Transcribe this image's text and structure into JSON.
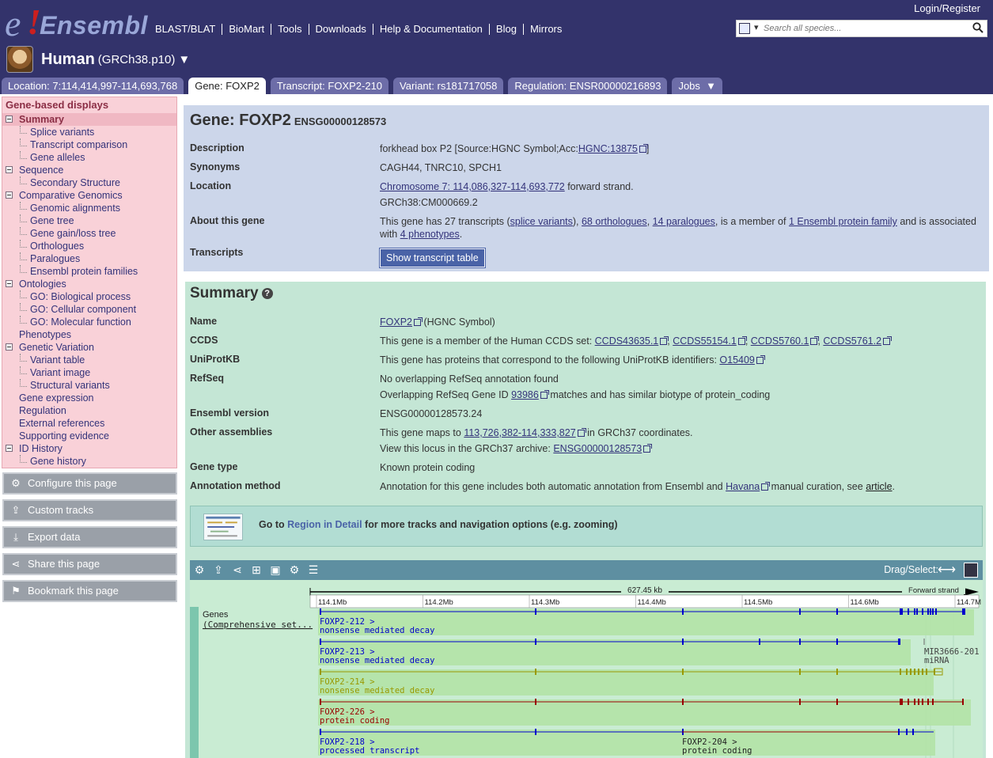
{
  "header": {
    "logo": "Ensembl",
    "nav": [
      "BLAST/BLAT",
      "BioMart",
      "Tools",
      "Downloads",
      "Help & Documentation",
      "Blog",
      "Mirrors"
    ],
    "login": "Login/Register",
    "search_placeholder": "Search all species...",
    "species": "Human",
    "assembly": "(GRCh38.p10)",
    "species_dropdown": "▼"
  },
  "tabs": [
    {
      "label": "Location: 7:114,414,997-114,693,768",
      "active": false
    },
    {
      "label": "Gene: FOXP2",
      "active": true
    },
    {
      "label": "Transcript: FOXP2-210",
      "active": false
    },
    {
      "label": "Variant: rs181717058",
      "active": false
    },
    {
      "label": "Regulation: ENSR00000216893",
      "active": false
    },
    {
      "label": "Jobs",
      "active": false
    }
  ],
  "jobs_arrow": "▼",
  "leftnav": {
    "header": "Gene-based displays",
    "items": [
      {
        "label": "Summary",
        "level": 0,
        "toggle": true,
        "selected": true
      },
      {
        "label": "Splice variants",
        "level": 1
      },
      {
        "label": "Transcript comparison",
        "level": 1
      },
      {
        "label": "Gene alleles",
        "level": 1
      },
      {
        "label": "Sequence",
        "level": 0,
        "toggle": true
      },
      {
        "label": "Secondary Structure",
        "level": 1
      },
      {
        "label": "Comparative Genomics",
        "level": 0,
        "toggle": true
      },
      {
        "label": "Genomic alignments",
        "level": 1
      },
      {
        "label": "Gene tree",
        "level": 1
      },
      {
        "label": "Gene gain/loss tree",
        "level": 1
      },
      {
        "label": "Orthologues",
        "level": 1
      },
      {
        "label": "Paralogues",
        "level": 1
      },
      {
        "label": "Ensembl protein families",
        "level": 1
      },
      {
        "label": "Ontologies",
        "level": 0,
        "toggle": true
      },
      {
        "label": "GO: Biological process",
        "level": 1
      },
      {
        "label": "GO: Cellular component",
        "level": 1
      },
      {
        "label": "GO: Molecular function",
        "level": 1
      },
      {
        "label": "Phenotypes",
        "level": 0
      },
      {
        "label": "Genetic Variation",
        "level": 0,
        "toggle": true
      },
      {
        "label": "Variant table",
        "level": 1
      },
      {
        "label": "Variant image",
        "level": 1
      },
      {
        "label": "Structural variants",
        "level": 1
      },
      {
        "label": "Gene expression",
        "level": 0
      },
      {
        "label": "Regulation",
        "level": 0
      },
      {
        "label": "External references",
        "level": 0
      },
      {
        "label": "Supporting evidence",
        "level": 0
      },
      {
        "label": "ID History",
        "level": 0,
        "toggle": true
      },
      {
        "label": "Gene history",
        "level": 1
      }
    ]
  },
  "tools": [
    {
      "label": "Configure this page",
      "icon": "gear-icon",
      "glyph": "⚙"
    },
    {
      "label": "Custom tracks",
      "icon": "upload-icon",
      "glyph": "⇪"
    },
    {
      "label": "Export data",
      "icon": "export-icon",
      "glyph": "⤓"
    },
    {
      "label": "Share this page",
      "icon": "share-icon",
      "glyph": "⋖"
    },
    {
      "label": "Bookmark this page",
      "icon": "bookmark-icon",
      "glyph": "⚑"
    }
  ],
  "gene": {
    "title": "Gene: FOXP2",
    "stable_id": "ENSG00000128573",
    "description_label": "Description",
    "description_text": "forkhead box P2 [Source:HGNC Symbol;Acc:",
    "description_link": "HGNC:13875",
    "description_end": "]",
    "synonyms_label": "Synonyms",
    "synonyms": "CAGH44, TNRC10, SPCH1",
    "location_label": "Location",
    "location_link": "Chromosome 7: 114,086,327-114,693,772",
    "location_strand": " forward strand.",
    "location_assembly": "GRCh38:CM000669.2",
    "about_label": "About this gene",
    "about_1": "This gene has 27 transcripts (",
    "about_splice": "splice variants",
    "about_2": "), ",
    "about_orth": "68 orthologues",
    "about_3": ", ",
    "about_para": "14 paralogues",
    "about_4": ", is a member of ",
    "about_fam": "1 Ensembl protein family",
    "about_5": " and is associated with ",
    "about_pheno": "4 phenotypes",
    "about_6": ".",
    "transcripts_label": "Transcripts",
    "transcripts_button": "Show transcript table"
  },
  "summary": {
    "title": "Summary",
    "help": "?",
    "name_label": "Name",
    "name_link": "FOXP2",
    "name_source": " (HGNC Symbol)",
    "ccds_label": "CCDS",
    "ccds_text": "This gene is a member of the Human CCDS set: ",
    "ccds_ids": [
      "CCDS43635.1",
      "CCDS55154.1",
      "CCDS5760.1",
      "CCDS5761.2"
    ],
    "uniprot_label": "UniProtKB",
    "uniprot_text": "This gene has proteins that correspond to the following UniProtKB identifiers: ",
    "uniprot_id": "O15409",
    "refseq_label": "RefSeq",
    "refseq_1": "No overlapping RefSeq annotation found",
    "refseq_2a": "Overlapping RefSeq Gene ID ",
    "refseq_id": "93986",
    "refseq_2b": " matches and has similar biotype of protein_coding",
    "version_label": "Ensembl version",
    "version": "ENSG00000128573.24",
    "other_label": "Other assemblies",
    "other_1a": "This gene maps to ",
    "other_link": "113,726,382-114,333,827",
    "other_1b": " in GRCh37 coordinates.",
    "other_2a": "View this locus in the GRCh37 archive: ",
    "other_2link": "ENSG00000128573",
    "type_label": "Gene type",
    "type": "Known protein coding",
    "annot_label": "Annotation method",
    "annot_a": "Annotation for this gene includes both automatic annotation from Ensembl and ",
    "annot_link": "Havana",
    "annot_b": " manual curation, see ",
    "annot_article": "article",
    "annot_c": ".",
    "rid_a": "Go to ",
    "rid_link": "Region in Detail",
    "rid_b": " for more tracks and navigation options (e.g. zooming)"
  },
  "image": {
    "drag_label": "Drag/Select:",
    "scale_label": "627.45 kb",
    "strand_label": "Forward strand",
    "ticks": [
      "114.1Mb",
      "114.2Mb",
      "114.3Mb",
      "114.4Mb",
      "114.5Mb",
      "114.6Mb",
      "114.7M"
    ],
    "track_label_1": "Genes",
    "track_label_2": "(Comprehensive set...",
    "transcripts": [
      {
        "name": "FOXP2-212 >",
        "biotype": "nonsense mediated decay",
        "color": "#0000cc"
      },
      {
        "name": "FOXP2-213 >",
        "biotype": "nonsense mediated decay",
        "color": "#0000cc"
      },
      {
        "name": "FOXP2-214 >",
        "biotype": "nonsense mediated decay",
        "color": "#999900"
      },
      {
        "name": "FOXP2-226 >",
        "biotype": "protein coding",
        "color": "#990000"
      },
      {
        "name": "FOXP2-218 >",
        "biotype": "processed transcript",
        "color": "#0000cc"
      },
      {
        "name": "FOXP2-204 >",
        "biotype": "protein coding",
        "color": "#990000"
      }
    ],
    "mirna_name": "MIR3666-201",
    "mirna_type": "miRNA"
  }
}
